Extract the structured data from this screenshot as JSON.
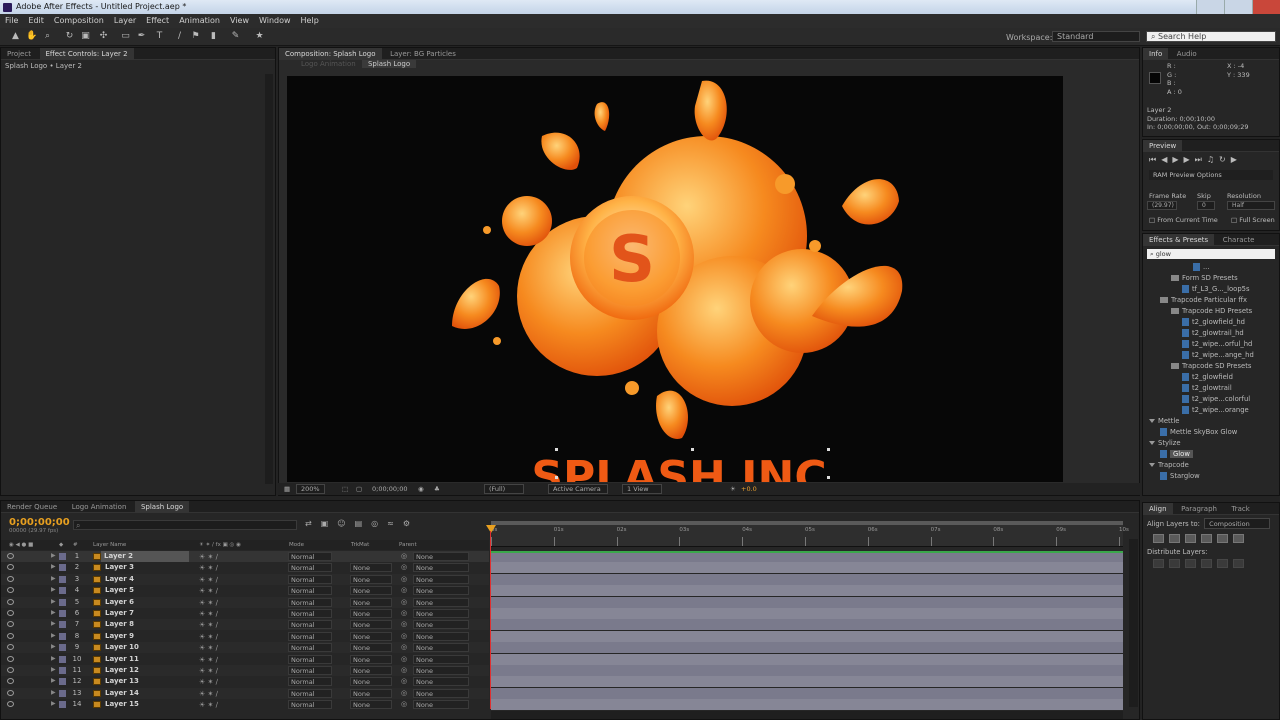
{
  "window": {
    "title": "Adobe After Effects - Untitled Project.aep *"
  },
  "menu": [
    "File",
    "Edit",
    "Composition",
    "Layer",
    "Effect",
    "Animation",
    "View",
    "Window",
    "Help"
  ],
  "toolbar": {
    "workspace_label": "Workspace:",
    "workspace_value": "Standard",
    "search_placeholder": "Search Help"
  },
  "left_panel": {
    "tabs": [
      "Project",
      "Effect Controls: Layer 2"
    ],
    "breadcrumb": "Splash Logo • Layer 2"
  },
  "comp_panel": {
    "tabs": [
      "Composition: Splash Logo",
      "Layer: BG Particles"
    ],
    "subtabs": [
      "Logo Animation",
      "Splash Logo"
    ],
    "logo_text": "SPLASH INC",
    "logo_letter": "S",
    "footer": {
      "zoom": "200%",
      "timecode": "0;00;00;00",
      "quality": "(Full)",
      "camera": "Active Camera",
      "view": "1 View",
      "exposure": "+0.0"
    }
  },
  "info_panel": {
    "tabs": [
      "Info",
      "Audio"
    ],
    "rgba": [
      "R :",
      "G :",
      "B :",
      "A : 0"
    ],
    "xy": [
      "X : -4",
      "Y : 339"
    ],
    "layer": "Layer 2",
    "duration": "Duration: 0;00;10;00",
    "inout": "In: 0;00;00;00, Out: 0;00;09;29"
  },
  "preview_panel": {
    "title": "Preview",
    "ram": "RAM Preview Options",
    "labels": [
      "Frame Rate",
      "Skip",
      "Resolution"
    ],
    "values": [
      "(29.97)",
      "0",
      "Half"
    ],
    "checks": [
      "From Current Time",
      "Full Screen"
    ]
  },
  "effects_panel": {
    "tabs": [
      "Effects & Presets",
      "Characte"
    ],
    "search": "glow",
    "items": [
      {
        "t": "...",
        "k": "dl",
        "lv": 4
      },
      {
        "t": "Form SD Presets",
        "k": "fold",
        "lv": 2
      },
      {
        "t": "tf_L3_G..._loop5s",
        "k": "dl",
        "lv": 3
      },
      {
        "t": "Trapcode Particular ffx",
        "k": "fold",
        "lv": 1
      },
      {
        "t": "Trapcode HD Presets",
        "k": "fold",
        "lv": 2
      },
      {
        "t": "t2_glowfield_hd",
        "k": "dl",
        "lv": 3
      },
      {
        "t": "t2_glowtrail_hd",
        "k": "dl",
        "lv": 3
      },
      {
        "t": "t2_wipe...orful_hd",
        "k": "dl",
        "lv": 3
      },
      {
        "t": "t2_wipe...ange_hd",
        "k": "dl",
        "lv": 3
      },
      {
        "t": "Trapcode SD Presets",
        "k": "fold",
        "lv": 2
      },
      {
        "t": "t2_glowfield",
        "k": "dl",
        "lv": 3
      },
      {
        "t": "t2_glowtrail",
        "k": "dl",
        "lv": 3
      },
      {
        "t": "t2_wipe...colorful",
        "k": "dl",
        "lv": 3
      },
      {
        "t": "t2_wipe...orange",
        "k": "dl",
        "lv": 3
      },
      {
        "t": "Mettle",
        "k": "tri",
        "lv": 0
      },
      {
        "t": "Mettle SkyBox Glow",
        "k": "dl",
        "lv": 1
      },
      {
        "t": "Stylize",
        "k": "tri",
        "lv": 0
      },
      {
        "t": "Glow",
        "k": "dl",
        "lv": 1
      },
      {
        "t": "Trapcode",
        "k": "tri",
        "lv": 0
      },
      {
        "t": "Starglow",
        "k": "dl",
        "lv": 1
      }
    ]
  },
  "align_panel": {
    "tabs": [
      "Align",
      "Paragraph",
      "Track"
    ],
    "align_to_label": "Align Layers to:",
    "align_to_value": "Composition",
    "distribute": "Distribute Layers:"
  },
  "timeline": {
    "tabs": [
      "Render Queue",
      "Logo Animation",
      "Splash Logo"
    ],
    "timecode": "0;00;00;00",
    "fps": "00000 (29.97 fps)",
    "headers": {
      "num": "#",
      "name": "Layer Name",
      "mode": "Mode",
      "trkmat": "TrkMat",
      "parent": "Parent"
    },
    "ruler": [
      "0s",
      "01s",
      "02s",
      "03s",
      "04s",
      "05s",
      "06s",
      "07s",
      "08s",
      "09s",
      "10s"
    ],
    "layers": [
      {
        "n": "1",
        "name": "Layer 2",
        "mode": "Normal",
        "trk": "",
        "parent": "None"
      },
      {
        "n": "2",
        "name": "Layer 3",
        "mode": "Normal",
        "trk": "None",
        "parent": "None"
      },
      {
        "n": "3",
        "name": "Layer 4",
        "mode": "Normal",
        "trk": "None",
        "parent": "None"
      },
      {
        "n": "4",
        "name": "Layer 5",
        "mode": "Normal",
        "trk": "None",
        "parent": "None"
      },
      {
        "n": "5",
        "name": "Layer 6",
        "mode": "Normal",
        "trk": "None",
        "parent": "None"
      },
      {
        "n": "6",
        "name": "Layer 7",
        "mode": "Normal",
        "trk": "None",
        "parent": "None"
      },
      {
        "n": "7",
        "name": "Layer 8",
        "mode": "Normal",
        "trk": "None",
        "parent": "None"
      },
      {
        "n": "8",
        "name": "Layer 9",
        "mode": "Normal",
        "trk": "None",
        "parent": "None"
      },
      {
        "n": "9",
        "name": "Layer 10",
        "mode": "Normal",
        "trk": "None",
        "parent": "None"
      },
      {
        "n": "10",
        "name": "Layer 11",
        "mode": "Normal",
        "trk": "None",
        "parent": "None"
      },
      {
        "n": "11",
        "name": "Layer 12",
        "mode": "Normal",
        "trk": "None",
        "parent": "None"
      },
      {
        "n": "12",
        "name": "Layer 13",
        "mode": "Normal",
        "trk": "None",
        "parent": "None"
      },
      {
        "n": "13",
        "name": "Layer 14",
        "mode": "Normal",
        "trk": "None",
        "parent": "None"
      },
      {
        "n": "14",
        "name": "Layer 15",
        "mode": "Normal",
        "trk": "None",
        "parent": "None"
      }
    ]
  },
  "colors": {
    "accent": "#e89a1a",
    "logo_orange": "#f47a14",
    "playhead": "#e03030",
    "bar": "#7a7a8c"
  }
}
